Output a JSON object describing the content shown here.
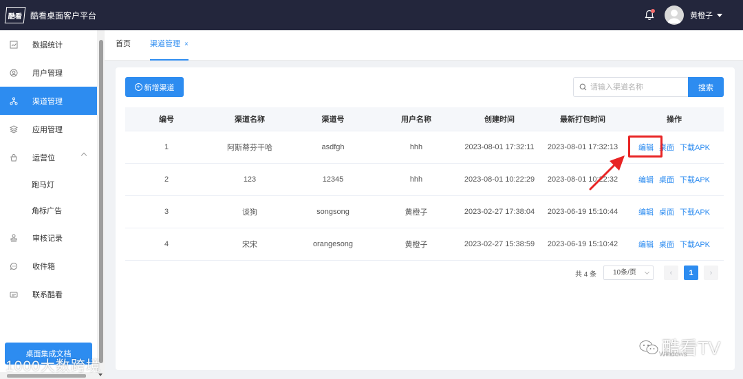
{
  "header": {
    "logo_text": "酷看",
    "app_title": "酷看桌面客户平台",
    "username": "黄橙子"
  },
  "sidebar": {
    "items": [
      {
        "label": "数据统计",
        "icon": "chart-icon"
      },
      {
        "label": "用户管理",
        "icon": "user-icon"
      },
      {
        "label": "渠道管理",
        "icon": "channel-icon",
        "active": true
      },
      {
        "label": "应用管理",
        "icon": "layers-icon"
      },
      {
        "label": "运营位",
        "icon": "bag-icon",
        "expanded": true
      }
    ],
    "subitems": [
      "跑马灯",
      "角标广告"
    ],
    "items_after": [
      {
        "label": "审核记录",
        "icon": "stamp-icon"
      },
      {
        "label": "收件箱",
        "icon": "message-icon"
      },
      {
        "label": "联系酷看",
        "icon": "contact-icon"
      }
    ],
    "doc_button": "桌面集成文档"
  },
  "tabs": {
    "home": "首页",
    "current": "渠道管理",
    "close_glyph": "×"
  },
  "toolbar": {
    "add_label": "新增渠道",
    "search_placeholder": "请输入渠道名称",
    "search_label": "搜索"
  },
  "table": {
    "headers": [
      "编号",
      "渠道名称",
      "渠道号",
      "用户名称",
      "创建时间",
      "最新打包时间",
      "操作"
    ],
    "rows": [
      [
        "1",
        "阿斯蒂芬干哈",
        "asdfgh",
        "hhh",
        "2023-08-01 17:32:11",
        "2023-08-01 17:32:13"
      ],
      [
        "2",
        "123",
        "12345",
        "hhh",
        "2023-08-01 10:22:29",
        "2023-08-01 10:22:32"
      ],
      [
        "3",
        "谈狗",
        "songsong",
        "黄橙子",
        "2023-02-27 17:38:04",
        "2023-06-19 15:10:44"
      ],
      [
        "4",
        "宋宋",
        "orangesong",
        "黄橙子",
        "2023-02-27 15:38:59",
        "2023-06-19 15:10:42"
      ]
    ],
    "actions": [
      "编辑",
      "桌面",
      "下载APK"
    ]
  },
  "pagination": {
    "total": "共 4 条",
    "page_size": "10条/页",
    "current_page": "1"
  },
  "watermarks": {
    "left": "1000大数跨境",
    "right": "酷看TV",
    "windows": "Windows"
  },
  "colors": {
    "header_bg": "#23263c",
    "primary": "#2d8cf0",
    "highlight": "#e82424"
  }
}
